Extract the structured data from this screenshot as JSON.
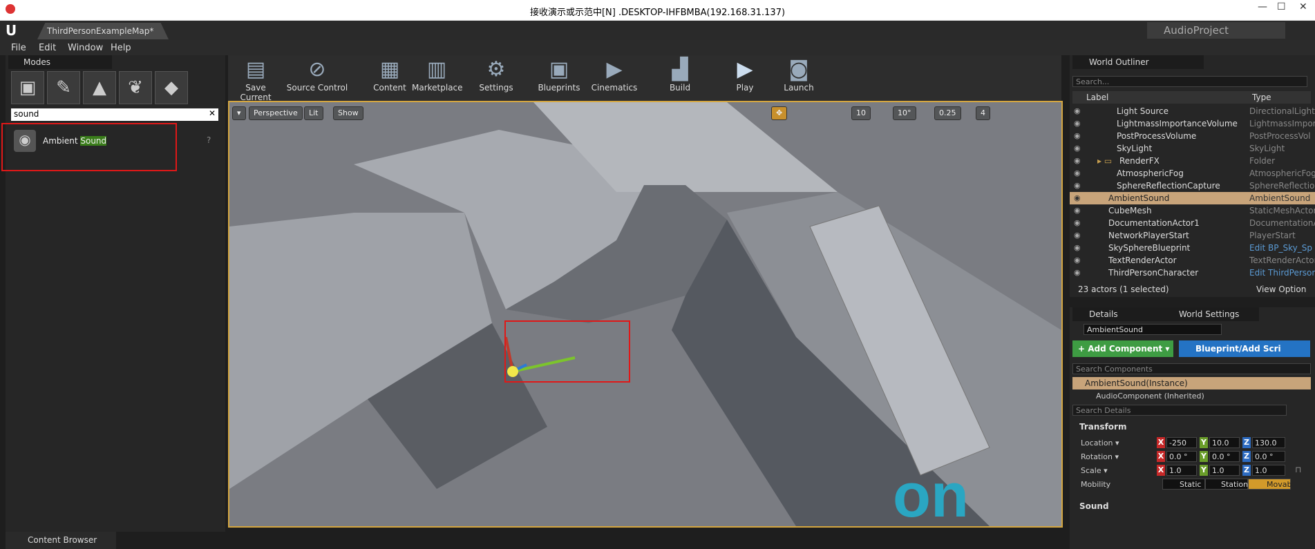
{
  "window": {
    "title": "接收演示或示范中[N] .DESKTOP-IHFBMBA(192.168.31.137)",
    "minimize": "—",
    "maximize": "☐",
    "close": "✕"
  },
  "tabs": {
    "map_tab": "ThirdPersonExampleMap*",
    "project": "AudioProject"
  },
  "menu": [
    "File",
    "Edit",
    "Window",
    "Help"
  ],
  "modes": {
    "title": "Modes",
    "icons": [
      "place-icon",
      "paint-icon",
      "landscape-icon",
      "foliage-icon",
      "geometry-icon"
    ],
    "search_value": "sound",
    "result_label": "Ambient ",
    "result_highlight": "Sound"
  },
  "toolbar": [
    {
      "label": "Save Current",
      "icon": "save-icon"
    },
    {
      "label": "Source Control",
      "icon": "source-control-icon"
    },
    {
      "label": "Content",
      "icon": "content-icon"
    },
    {
      "label": "Marketplace",
      "icon": "marketplace-icon"
    },
    {
      "label": "Settings",
      "icon": "settings-icon"
    },
    {
      "label": "Blueprints",
      "icon": "blueprints-icon"
    },
    {
      "label": "Cinematics",
      "icon": "cinematics-icon"
    },
    {
      "label": "Build",
      "icon": "build-icon"
    },
    {
      "label": "Play",
      "icon": "play-icon"
    },
    {
      "label": "Launch",
      "icon": "launch-icon"
    }
  ],
  "viewport": {
    "perspective": "Perspective",
    "lit": "Lit",
    "show": "Show",
    "grid_snap": "10",
    "rot_snap": "10°",
    "scale_snap": "0.25",
    "camera_speed": "4"
  },
  "outliner": {
    "title": "World Outliner",
    "search_placeholder": "Search...",
    "col_label": "Label",
    "col_type": "Type",
    "rows": [
      {
        "label": "Light Source",
        "type": "DirectionalLight"
      },
      {
        "label": "LightmassImportanceVolume",
        "type": "LightmassImpor"
      },
      {
        "label": "PostProcessVolume",
        "type": "PostProcessVol"
      },
      {
        "label": "SkyLight",
        "type": "SkyLight"
      },
      {
        "label": "RenderFX",
        "type": "Folder"
      },
      {
        "label": "AtmosphericFog",
        "type": "AtmosphericFog"
      },
      {
        "label": "SphereReflectionCapture",
        "type": "SphereReflection"
      },
      {
        "label": "AmbientSound",
        "type": "AmbientSound"
      },
      {
        "label": "CubeMesh",
        "type": "StaticMeshActor"
      },
      {
        "label": "DocumentationActor1",
        "type": "DocumentationA"
      },
      {
        "label": "NetworkPlayerStart",
        "type": "PlayerStart"
      },
      {
        "label": "SkySphereBlueprint",
        "type": "Edit BP_Sky_Sp"
      },
      {
        "label": "TextRenderActor",
        "type": "TextRenderActor"
      },
      {
        "label": "ThirdPersonCharacter",
        "type": "Edit ThirdPerson"
      }
    ],
    "status": "23 actors (1 selected)",
    "view_options": "View Option"
  },
  "details": {
    "tab_details": "Details",
    "tab_world": "World Settings",
    "name_value": "AmbientSound",
    "add_component": "+ Add Component ▾",
    "blueprint": "Blueprint/Add Scri",
    "search_components": "Search Components",
    "instance": "AmbientSound(Instance)",
    "audio_component": "AudioComponent (Inherited)",
    "search_details": "Search Details",
    "section_transform": "Transform",
    "location_label": "Location ▾",
    "rotation_label": "Rotation ▾",
    "scale_label": "Scale ▾",
    "mobility_label": "Mobility",
    "location": [
      "-250",
      "10.0",
      "130.0"
    ],
    "rotation": [
      "0.0 °",
      "0.0 °",
      "0.0 °"
    ],
    "scale": [
      "1.0",
      "1.0",
      "1.0"
    ],
    "mobility": [
      "Static",
      "Station",
      "Movab"
    ],
    "section_sound": "Sound"
  },
  "content_browser": "Content Browser"
}
